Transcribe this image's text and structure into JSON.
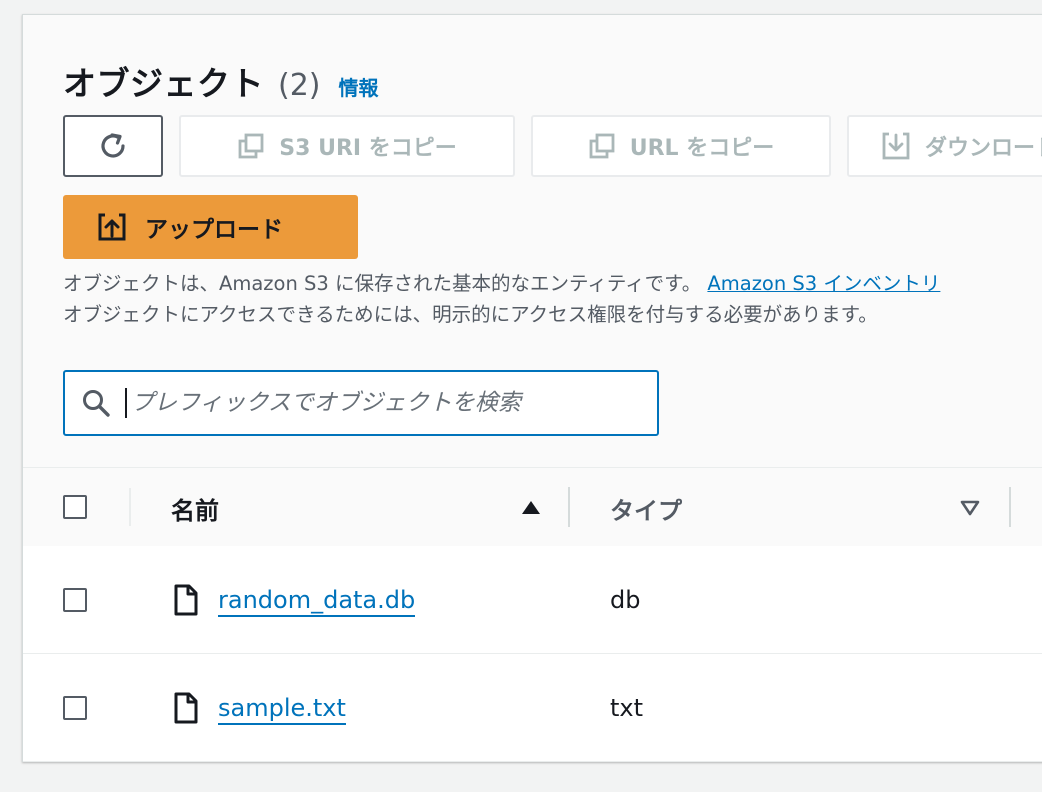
{
  "header": {
    "title": "オブジェクト",
    "count": "(2)",
    "info_link": "情報"
  },
  "toolbar": {
    "copy_s3_uri_label": "S3 URI をコピー",
    "copy_url_label": "URL をコピー",
    "download_label": "ダウンロード",
    "upload_label": "アップロード"
  },
  "description": {
    "line1": "オブジェクトは、Amazon S3 に保存された基本的なエンティティです。",
    "line1_link": "Amazon S3 インベントリ",
    "line2": "オブジェクトにアクセスできるためには、明示的にアクセス権限を付与する必要があります。"
  },
  "search": {
    "placeholder": "プレフィックスでオブジェクトを検索"
  },
  "table": {
    "columns": [
      {
        "label": "名前",
        "sort": "ascending"
      },
      {
        "label": "タイプ",
        "sort": "none"
      }
    ],
    "rows": [
      {
        "name": "random_data.db",
        "type": "db"
      },
      {
        "name": "sample.txt",
        "type": "txt"
      }
    ]
  },
  "icons": {
    "refresh": "refresh-icon",
    "copy": "copy-icon",
    "download": "download-icon",
    "upload": "upload-icon",
    "search": "search-icon",
    "file": "file-icon",
    "sort_asc": "sort-ascending-icon",
    "sort_none": "sort-descending-outline-icon"
  },
  "colors": {
    "primary_orange": "#ec9a3a",
    "link_blue": "#0073bb",
    "disabled_text": "#aab7b8"
  }
}
